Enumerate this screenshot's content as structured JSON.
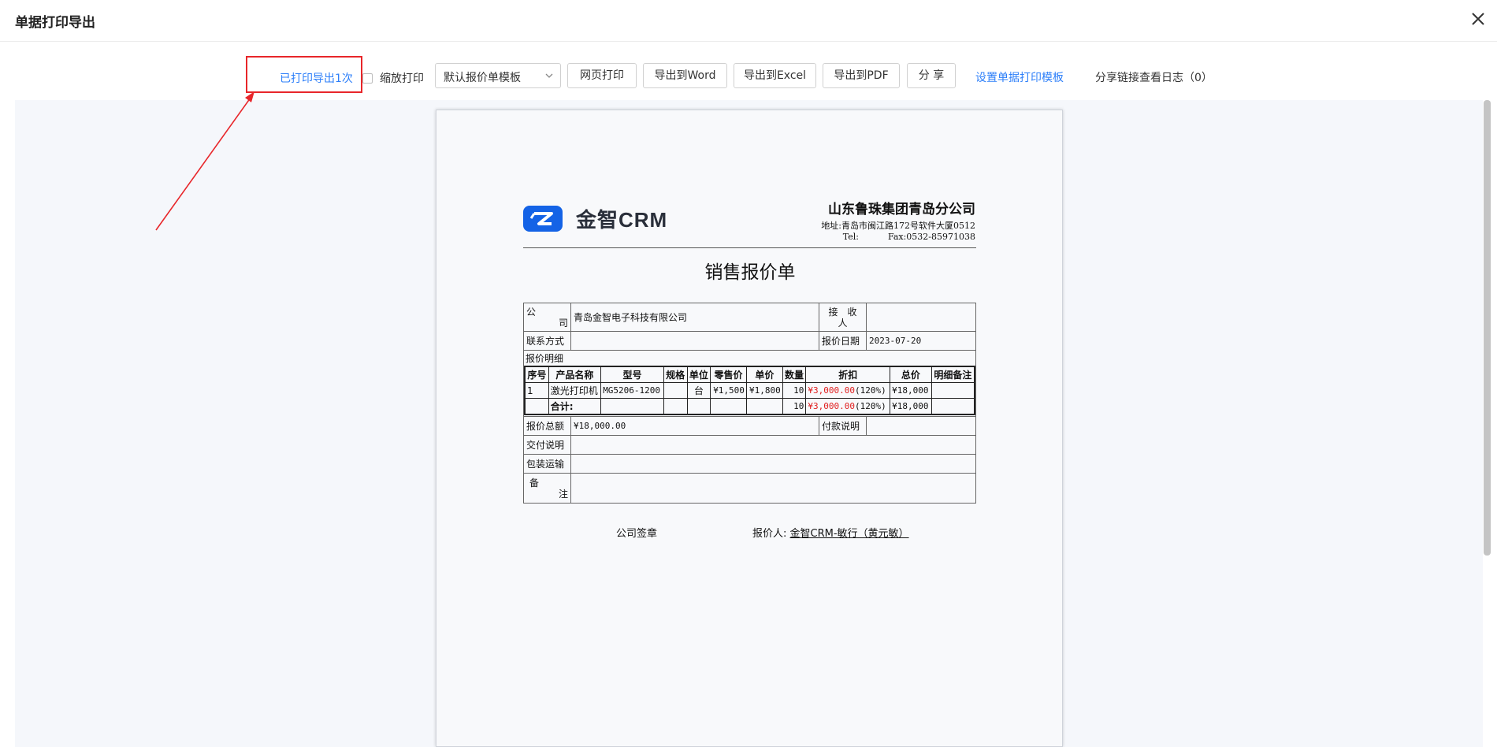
{
  "dialog": {
    "title": "单据打印导出",
    "close_icon": "close-icon"
  },
  "toolbar": {
    "printed_count": "已打印导出1次",
    "scale_print_label": "缩放打印",
    "template_select": "默认报价单模板",
    "btn_web_print": "网页打印",
    "btn_export_word": "导出到Word",
    "btn_export_excel": "导出到Excel",
    "btn_export_pdf": "导出到PDF",
    "btn_share": "分 享",
    "link_set_template": "设置单据打印模板",
    "share_log": "分享链接查看日志（0）"
  },
  "annotation": {
    "highlight_color": "#e8262a"
  },
  "doc": {
    "brand": "金智CRM",
    "company_name": "山东鲁珠集团青岛分公司",
    "address": "地址:青岛市闽江路172号软件大厦0512",
    "tel": "Tel:",
    "fax": "Fax:0532-85971038",
    "title": "销售报价单",
    "label_company_top": "公",
    "label_company_bottom": "司",
    "company_value": "青岛金智电子科技有限公司",
    "label_receiver_top": "接　收",
    "label_receiver_bottom": "人",
    "receiver_value": "",
    "label_contact": "联系方式",
    "contact_value": "",
    "label_quote_date": "报价日期",
    "quote_date": "2023-07-20",
    "label_detail": "报价明细",
    "item_headers": [
      "序号",
      "产品名称",
      "型号",
      "规格",
      "单位",
      "零售价",
      "单价",
      "数量",
      "折扣",
      "总价",
      "明细备注"
    ],
    "items": [
      {
        "no": "1",
        "name": "激光打印机",
        "model": "MG5206-1200",
        "spec": "",
        "unit": "台",
        "retail": "¥1,500",
        "price": "¥1,800",
        "qty": "10",
        "discount_amt": "¥3,000.00",
        "discount_pct": "(120%)",
        "total": "¥18,000",
        "note": ""
      }
    ],
    "sum_label": "合计:",
    "sum_qty": "10",
    "sum_discount_amt": "¥3,000.00",
    "sum_discount_pct": "(120%)",
    "sum_total": "¥18,000",
    "label_total_amount": "报价总额",
    "total_amount": "¥18,000.00",
    "label_payment": "付款说明",
    "payment_value": "",
    "label_delivery": "交付说明",
    "label_packaging": "包装运输",
    "label_remark_top": "备",
    "label_remark_bottom": "注",
    "company_seal": "公司签章",
    "quoter_label": "报价人:",
    "quoter_value": "金智CRM-敏行（黄元敏）"
  }
}
